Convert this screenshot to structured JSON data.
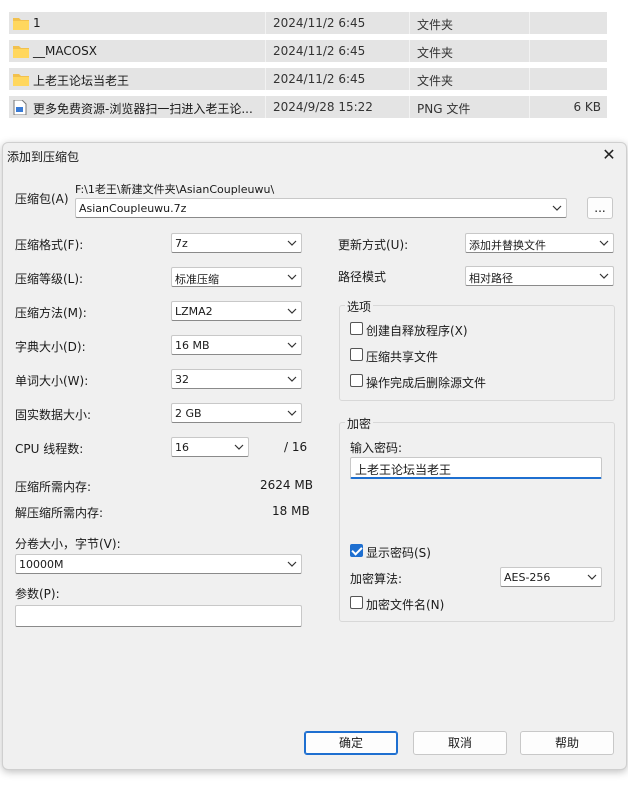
{
  "files": [
    {
      "name": "1",
      "date": "2024/11/2 6:45",
      "type": "文件夹",
      "size": "",
      "icon": "folder-icon"
    },
    {
      "name": "__MACOSX",
      "date": "2024/11/2 6:45",
      "type": "文件夹",
      "size": "",
      "icon": "folder-icon"
    },
    {
      "name": "上老王论坛当老王",
      "date": "2024/11/2 6:45",
      "type": "文件夹",
      "size": "",
      "icon": "folder-icon"
    },
    {
      "name": "更多免费资源-浏览器扫一扫进入老王论...",
      "date": "2024/9/28 15:22",
      "type": "PNG 文件",
      "size": "6 KB",
      "icon": "png-file-icon"
    }
  ],
  "dialog": {
    "title": "添加到压缩包",
    "archive_label": "压缩包(A)",
    "archive_path": "F:\\1老王\\新建文件夹\\AsianCoupleuwu\\",
    "archive_name": "AsianCoupleuwu.7z",
    "browse_label": "...",
    "left": {
      "format_label": "压缩格式(F):",
      "format_value": "7z",
      "level_label": "压缩等级(L):",
      "level_value": "标准压缩",
      "method_label": "压缩方法(M):",
      "method_value": "LZMA2",
      "dict_label": "字典大小(D):",
      "dict_value": "16 MB",
      "word_label": "单词大小(W):",
      "word_value": "32",
      "solid_label": "固实数据大小:",
      "solid_value": "2 GB",
      "cpu_label": "CPU 线程数:",
      "cpu_value": "16",
      "cpu_total": "/ 16",
      "mem_comp_label": "压缩所需内存:",
      "mem_comp_value": "2624 MB",
      "mem_decomp_label": "解压缩所需内存:",
      "mem_decomp_value": "18 MB",
      "split_label": "分卷大小，字节(V):",
      "split_value": "10000M",
      "params_label": "参数(P):",
      "params_value": ""
    },
    "right": {
      "update_label": "更新方式(U):",
      "update_value": "添加并替换文件",
      "path_label": "路径模式",
      "path_value": "相对路径",
      "options_title": "选项",
      "opt_sfx": "创建自释放程序(X)",
      "opt_shared": "压缩共享文件",
      "opt_delete": "操作完成后删除源文件",
      "enc_title": "加密",
      "pwd_label": "输入密码:",
      "pwd_value": "上老王论坛当老王",
      "show_pwd": "显示密码(S)",
      "alg_label": "加密算法:",
      "alg_value": "AES-256",
      "enc_names": "加密文件名(N)"
    },
    "buttons": {
      "ok": "确定",
      "cancel": "取消",
      "help": "帮助"
    }
  }
}
